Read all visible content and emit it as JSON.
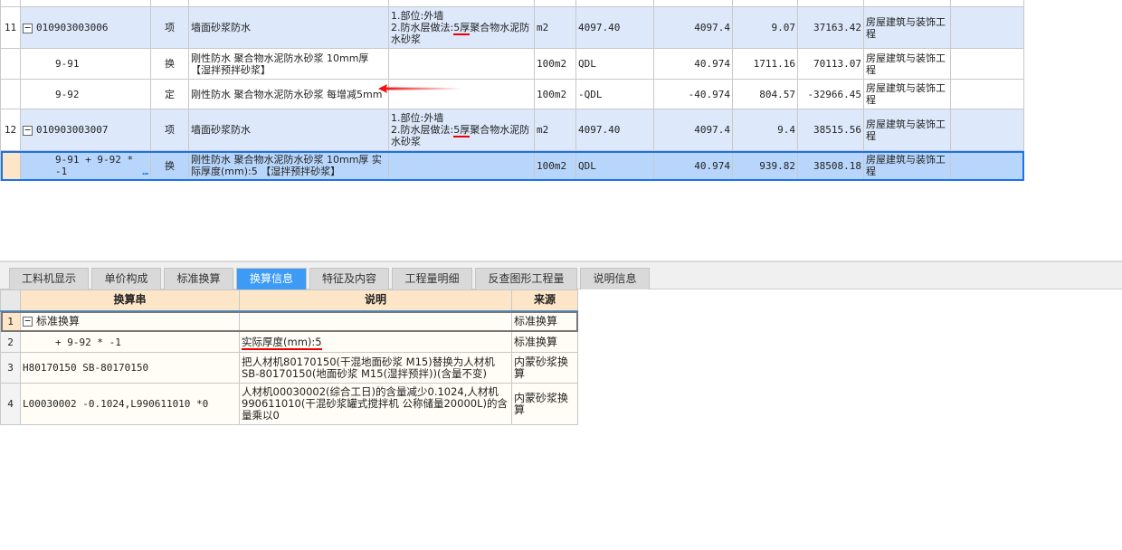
{
  "main_table": {
    "rows": [
      {
        "no": "11",
        "code": "010903003006",
        "type": "项",
        "name": "墙面砂浆防水",
        "features": [
          "1.部位:外墙",
          "2.防水层做法:",
          "5厚",
          "聚合物水泥防水砂浆"
        ],
        "unit": "m2",
        "expr": "4097.40",
        "qty": "4097.4",
        "price": "9.07",
        "total": "37163.42",
        "major": "房屋建筑与装饰工程",
        "kind": "item"
      },
      {
        "no": "",
        "code": "9-91",
        "type": "换",
        "name": "刚性防水 聚合物水泥防水砂浆 10mm厚 【湿拌预拌砂浆】",
        "unit": "100m2",
        "expr": "QDL",
        "qty": "40.974",
        "price": "1711.16",
        "total": "70113.07",
        "major": "房屋建筑与装饰工程",
        "kind": "sub"
      },
      {
        "no": "",
        "code": "9-92",
        "type": "定",
        "name": "刚性防水 聚合物水泥防水砂浆 每增减5mm",
        "unit": "100m2",
        "expr": "-QDL",
        "qty": "-40.974",
        "price": "804.57",
        "total": "-32966.45",
        "major": "房屋建筑与装饰工程",
        "kind": "sub"
      },
      {
        "no": "12",
        "code": "010903003007",
        "type": "项",
        "name": "墙面砂浆防水",
        "features": [
          "1.部位:外墙",
          "2.防水层做法:",
          "5厚",
          "聚合物水泥防水砂浆"
        ],
        "unit": "m2",
        "expr": "4097.40",
        "qty": "4097.4",
        "price": "9.4",
        "total": "38515.56",
        "major": "房屋建筑与装饰工程",
        "kind": "item"
      },
      {
        "no": "",
        "code": "9-91 + 9-92 * -1",
        "more": "…",
        "type": "换",
        "name": "刚性防水 聚合物水泥防水砂浆 10mm厚 实际厚度(mm):5 【湿拌预拌砂浆】",
        "unit": "100m2",
        "expr": "QDL",
        "qty": "40.974",
        "price": "939.82",
        "total": "38508.18",
        "major": "房屋建筑与装饰工程",
        "kind": "sel"
      }
    ]
  },
  "tabs": [
    "工料机显示",
    "单价构成",
    "标准换算",
    "换算信息",
    "特征及内容",
    "工程量明细",
    "反查图形工程量",
    "说明信息"
  ],
  "active_tab": 3,
  "conv_table": {
    "headers": [
      "换算串",
      "说明",
      "来源"
    ],
    "rows": [
      {
        "no": "1",
        "str": "标准换算",
        "desc": "",
        "src": "标准换算"
      },
      {
        "no": "2",
        "str": "+ 9-92 * -1",
        "desc": "实际厚度(mm):5",
        "src": "标准换算"
      },
      {
        "no": "3",
        "str": "H80170150 SB-80170150",
        "desc": "把人材机80170150(干混地面砂浆 M15)替换为人材机SB-80170150(地面砂浆 M15(湿拌预拌))(含量不变)",
        "src": "内蒙砂浆换算"
      },
      {
        "no": "4",
        "str": "L00030002 -0.1024,L990611010 *0",
        "desc": "人材机00030002(综合工日)的含量减少0.1024,人材机990611010(干混砂浆罐式搅拌机 公称储量20000L)的含量乘以0",
        "src": "内蒙砂浆换算"
      }
    ]
  },
  "colors": {
    "accent": "#3d9bf5",
    "item_row": "#dde9fb",
    "selected_row": "#b8d6fb",
    "annotation": "#e00000"
  }
}
